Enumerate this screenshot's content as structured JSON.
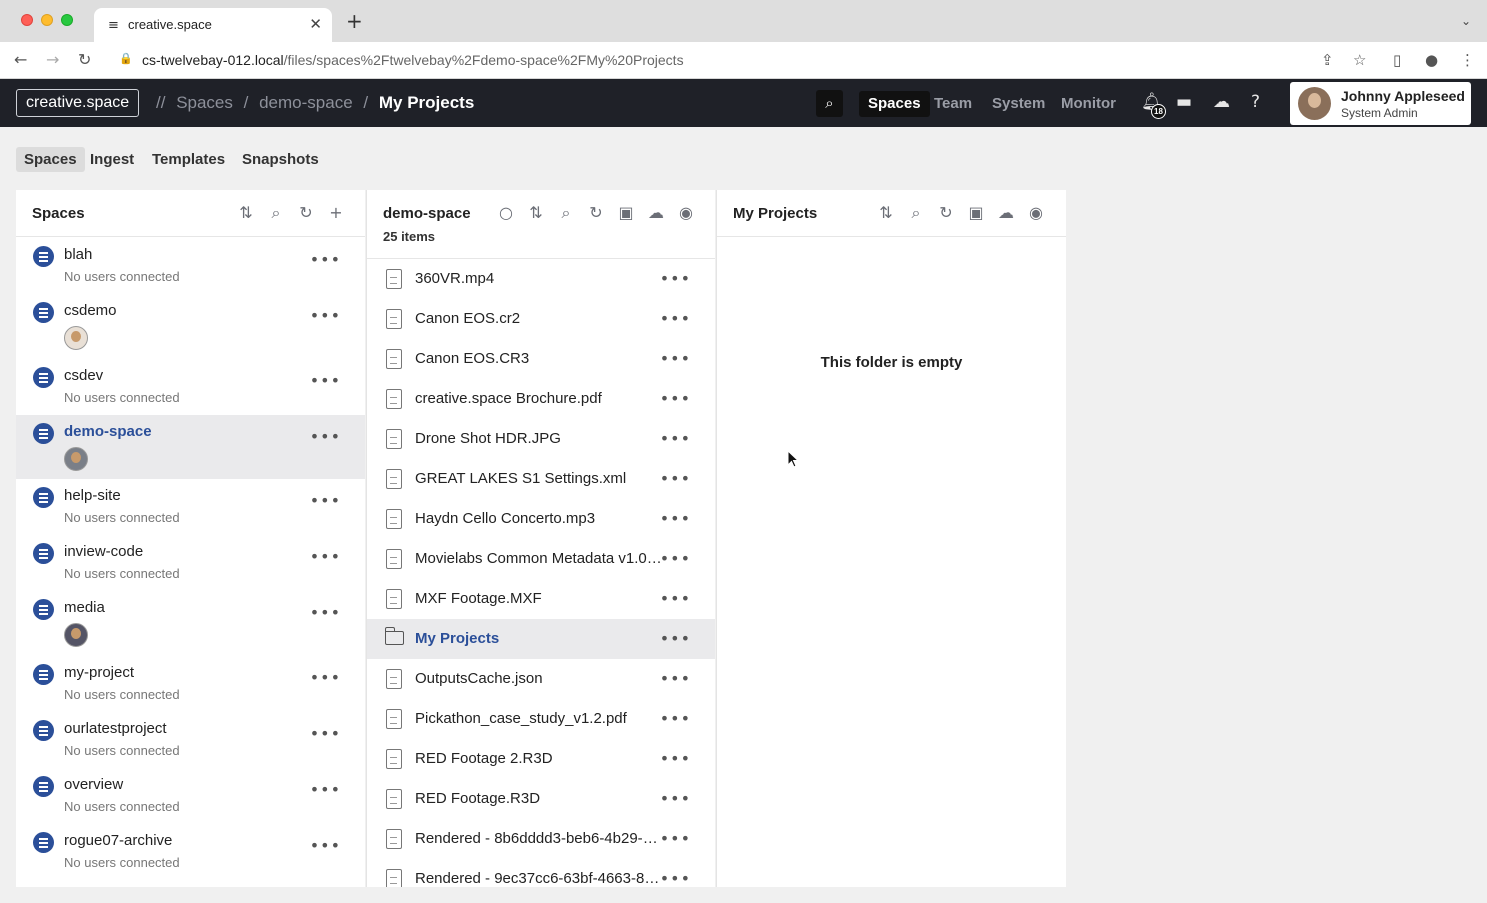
{
  "browser": {
    "tab_title": "creative.space",
    "tab_favicon": "≡",
    "tab_close": "✕",
    "new_tab": "+",
    "tab_menu": "⌄",
    "url_host": "cs-twelvebay-012.local",
    "url_path": "/files/spaces%2Ftwelvebay%2Fdemo-space%2FMy%20Projects"
  },
  "header": {
    "logo": "creative.space",
    "crumbs": [
      "//",
      "Spaces",
      "/",
      "demo-space",
      "/"
    ],
    "crumb_current": "My Projects",
    "nav": [
      "Spaces",
      "Team",
      "System",
      "Monitor"
    ],
    "notification_count": "18",
    "user_name": "Johnny Appleseed",
    "user_role": "System Admin"
  },
  "subtabs": [
    "Spaces",
    "Ingest",
    "Templates",
    "Snapshots"
  ],
  "spaces_panel": {
    "title": "Spaces",
    "items": [
      {
        "name": "blah",
        "status": "No users connected"
      },
      {
        "name": "csdemo",
        "status": ""
      },
      {
        "name": "csdev",
        "status": "No users connected"
      },
      {
        "name": "demo-space",
        "status": ""
      },
      {
        "name": "help-site",
        "status": "No users connected"
      },
      {
        "name": "inview-code",
        "status": "No users connected"
      },
      {
        "name": "media",
        "status": ""
      },
      {
        "name": "my-project",
        "status": "No users connected"
      },
      {
        "name": "ourlatestproject",
        "status": "No users connected"
      },
      {
        "name": "overview",
        "status": "No users connected"
      },
      {
        "name": "rogue07-archive",
        "status": "No users connected"
      }
    ]
  },
  "files_panel": {
    "title": "demo-space",
    "count": "25 items",
    "items": [
      "360VR.mp4",
      "Canon EOS.cr2",
      "Canon EOS.CR3",
      "creative.space Brochure.pdf",
      "Drone Shot HDR.JPG",
      "GREAT LAKES S1 Settings.xml",
      "Haydn Cello Concerto.mp3",
      "Movielabs Common Metadata v1.07....",
      "MXF Footage.MXF",
      "My Projects",
      "OutputsCache.json",
      "Pickathon_case_study_v1.2.pdf",
      "RED Footage 2.R3D",
      "RED Footage.R3D",
      "Rendered - 8b6dddd3-beb6-4b29-be...",
      "Rendered - 9ec37cc6-63bf-4663-88c4..."
    ]
  },
  "folder_panel": {
    "title": "My Projects",
    "empty_text": "This folder is empty"
  },
  "icons": {
    "more": "•••",
    "search": "⌕",
    "sort": "⇅",
    "refresh": "↻",
    "add": "+"
  },
  "colors": {
    "header_bg": "#1f2128",
    "accent": "#2b4f99"
  }
}
